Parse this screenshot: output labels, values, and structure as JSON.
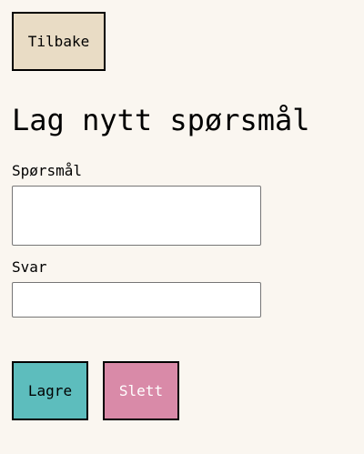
{
  "nav": {
    "back_label": "Tilbake"
  },
  "page": {
    "title": "Lag nytt spørsmål"
  },
  "form": {
    "question": {
      "label": "Spørsmål",
      "value": "",
      "placeholder": ""
    },
    "answer": {
      "label": "Svar",
      "value": "",
      "placeholder": ""
    }
  },
  "actions": {
    "save_label": "Lagre",
    "delete_label": "Slett"
  },
  "colors": {
    "background": "#faf6f0",
    "back_button": "#e9dcc5",
    "save_button": "#5dbdbd",
    "delete_button": "#d98aa8"
  }
}
